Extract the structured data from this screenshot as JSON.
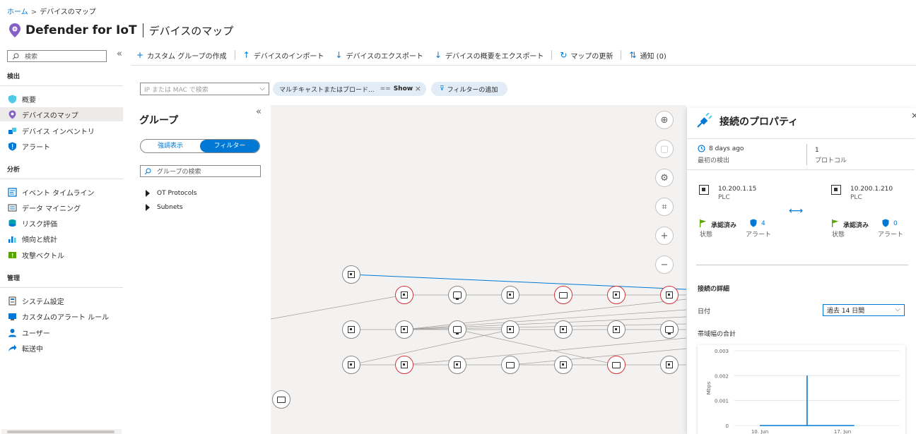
{
  "breadcrumb": {
    "home": "ホーム",
    "separator": ">",
    "current": "デバイスのマップ"
  },
  "header": {
    "app_name": "Defender for IoT",
    "page_name": "デバイスのマップ"
  },
  "nav": {
    "search_placeholder": "検索",
    "collapse_glyph": "«",
    "sections": [
      {
        "label": "検出",
        "items": [
          {
            "label": "概要",
            "icon": "shield-overview-icon",
            "color": "#50c8e8"
          },
          {
            "label": "デバイスのマップ",
            "icon": "map-pin-icon",
            "color": "#8661c5",
            "active": true
          },
          {
            "label": "デバイス インベントリ",
            "icon": "cubes-icon",
            "color": "#0078d4"
          },
          {
            "label": "アラート",
            "icon": "shield-alert-icon",
            "color": "#0078d4"
          }
        ]
      },
      {
        "label": "分析",
        "items": [
          {
            "label": "イベント タイムライン",
            "icon": "timeline-icon",
            "color": "#0078d4"
          },
          {
            "label": "データ マイニング",
            "icon": "data-mining-icon",
            "color": "#605e5c"
          },
          {
            "label": "リスク評価",
            "icon": "risk-icon",
            "color": "#00a2ad"
          },
          {
            "label": "傾向と統計",
            "icon": "bar-chart-icon",
            "color": "#0078d4"
          },
          {
            "label": "攻撃ベクトル",
            "icon": "attack-vector-icon",
            "color": "#57a300"
          }
        ]
      },
      {
        "label": "管理",
        "items": [
          {
            "label": "システム設定",
            "icon": "system-settings-icon",
            "color": "#605e5c"
          },
          {
            "label": "カスタムのアラート ルール",
            "icon": "alert-rule-icon",
            "color": "#0078d4"
          },
          {
            "label": "ユーザー",
            "icon": "user-icon",
            "color": "#0078d4"
          },
          {
            "label": "転送中",
            "icon": "forward-icon",
            "color": "#0078d4"
          }
        ]
      }
    ]
  },
  "commands": [
    {
      "label": "カスタム グループの作成",
      "glyph": "+"
    },
    {
      "label": "デバイスのインポート",
      "glyph": "↑"
    },
    {
      "label": "デバイスのエクスポート",
      "glyph": "↓"
    },
    {
      "label": "デバイスの概要をエクスポート",
      "glyph": "↓"
    },
    {
      "label": "マップの更新",
      "glyph": "↻"
    },
    {
      "label": "通知 (0)",
      "glyph": "⇅"
    }
  ],
  "filters": {
    "ip_placeholder": "IP または MAC で検索",
    "pill_field": "マルチキャストまたはブロード...",
    "pill_operator": "==",
    "pill_value": "Show",
    "add_filter": "フィルターの追加"
  },
  "groups": {
    "title": "グループ",
    "toggle_left": "強調表示",
    "toggle_right": "フィルター",
    "search_placeholder": "グループの検索",
    "tree": [
      "OT Protocols",
      "Subnets"
    ]
  },
  "map": {
    "controls": [
      {
        "name": "recenter-icon",
        "glyph": "⊕"
      },
      {
        "name": "select-area-icon",
        "glyph": "▢",
        "dim": true
      },
      {
        "name": "settings-icon",
        "glyph": "⚙"
      },
      {
        "name": "fit-screen-icon",
        "glyph": "⌗"
      },
      {
        "name": "zoom-in-icon",
        "glyph": "+"
      },
      {
        "name": "zoom-out-icon",
        "glyph": "−"
      }
    ]
  },
  "properties": {
    "title": "接続のプロパティ",
    "first_detected_value": "8 days ago",
    "first_detected_label": "最初の検出",
    "protocol_value": "1",
    "protocol_label": "プロトコル",
    "source": {
      "ip": "10.200.1.15",
      "type": "PLC",
      "status": "承認済み",
      "status_label": "状態",
      "alerts": "4",
      "alerts_label": "アラート"
    },
    "dest": {
      "ip": "10.200.1.210",
      "type": "PLC",
      "status": "承認済み",
      "status_label": "状態",
      "alerts": "0",
      "alerts_label": "アラート"
    },
    "link_glyph": "⟷",
    "details_header": "接続の詳細",
    "date_label": "日付",
    "date_value": "過去 14 日間",
    "bandwidth_label": "帯域幅の合計",
    "colors": {
      "accent": "#0078d4",
      "alert": "#d13438",
      "approved_flag": "#57a300"
    }
  },
  "chart_data": {
    "type": "line",
    "ylabel": "Mbps",
    "yticks": [
      "0.003",
      "0.002",
      "0.001",
      "0"
    ],
    "ylim": [
      0,
      0.003
    ],
    "xticks": [
      "10. Jun",
      "17. Jun"
    ],
    "grid": true,
    "series": [
      {
        "values": [
          {
            "x": "10. Jun",
            "y": 0
          },
          {
            "x": "14. Jun",
            "y": 0
          },
          {
            "x": "14. Jun",
            "y": 0.002
          },
          {
            "x": "14. Jun",
            "y": 0
          },
          {
            "x": "17. Jun",
            "y": 0
          },
          {
            "x": "18. Jun",
            "y": 0
          }
        ]
      }
    ]
  }
}
